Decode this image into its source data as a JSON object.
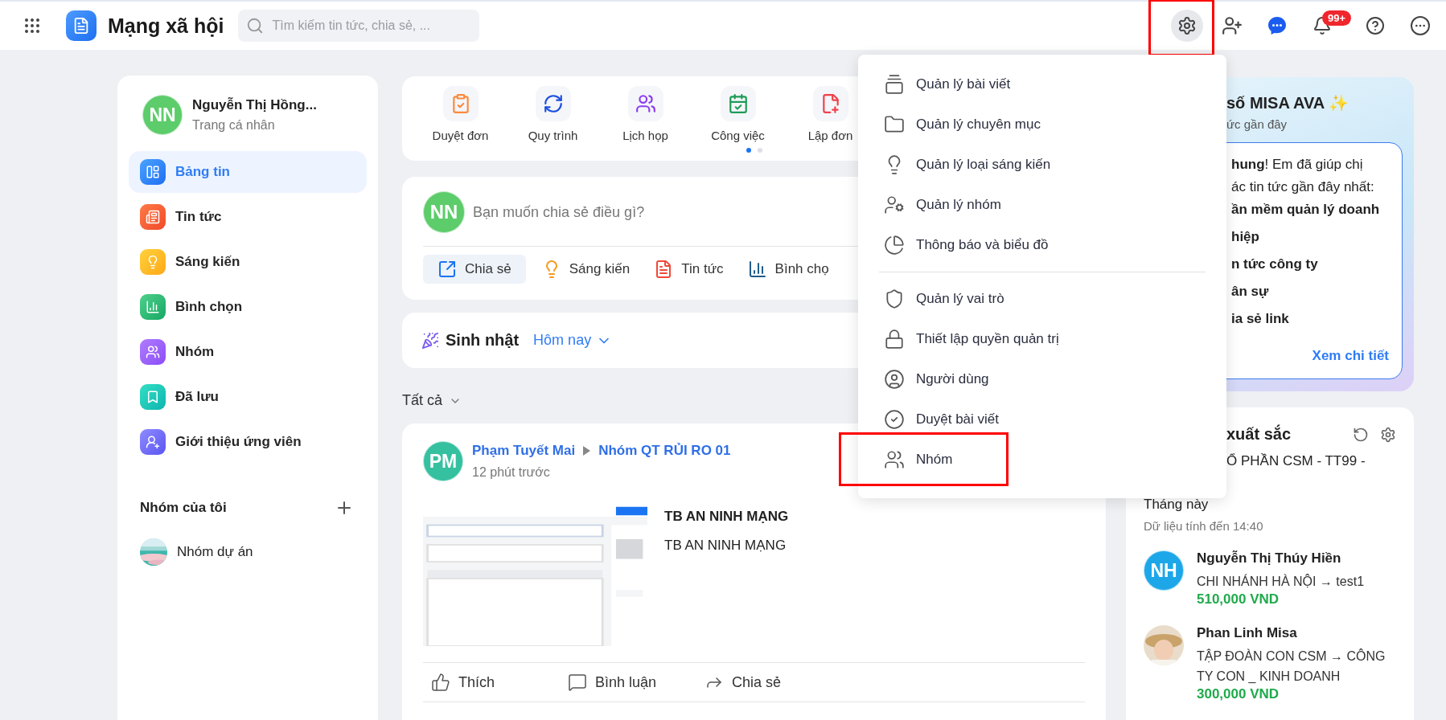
{
  "top_bar": {
    "title": "Mạng xã hội",
    "search": {
      "placeholder": "Tìm kiếm tin tức, chia sẻ, ..."
    },
    "actions": [
      {
        "kind": "settings",
        "selected": true,
        "annotated": true
      },
      {
        "kind": "add-user",
        "selected": false,
        "annotated": false
      },
      {
        "kind": "chat",
        "selected": false,
        "annotated": false
      },
      {
        "kind": "notifications",
        "selected": false,
        "annotated": false,
        "badge": "99+"
      },
      {
        "kind": "help",
        "selected": false,
        "annotated": false
      },
      {
        "kind": "more",
        "selected": false,
        "annotated": false
      }
    ]
  },
  "sidebar": {
    "profile": {
      "initials": "NN",
      "name": "Nguyễn Thị Hồng...",
      "subtitle": "Trang cá nhân"
    },
    "items": [
      {
        "label": "Bảng tin",
        "selected": true
      },
      {
        "label": "Tin tức",
        "selected": false
      },
      {
        "label": "Sáng kiến",
        "selected": false
      },
      {
        "label": "Bình chọn",
        "selected": false
      },
      {
        "label": "Nhóm",
        "selected": false
      },
      {
        "label": "Đã lưu",
        "selected": false
      },
      {
        "label": "Giới thiệu ứng viên",
        "selected": false
      }
    ],
    "groups_title": "Nhóm của tôi",
    "groups": [
      {
        "name": "Nhóm dự án",
        "kind": "picture"
      }
    ]
  },
  "shortcuts": {
    "items": [
      "Duyệt đơn",
      "Quy trình",
      "Lịch họp",
      "Công việc",
      "Lập đơn"
    ],
    "pages": [
      {
        "selected": true
      },
      {
        "selected": false
      }
    ]
  },
  "composer": {
    "initials": "NN",
    "placeholder": "Bạn muốn chia sẻ điều gì?",
    "actions": [
      {
        "label": "Chia sẻ",
        "selected": true
      },
      {
        "label": "Sáng kiến",
        "selected": false
      },
      {
        "label": "Tin tức",
        "selected": false
      },
      {
        "label": "Bình chọ",
        "selected": false
      }
    ]
  },
  "birthday": {
    "title": "Sinh nhật",
    "filter": "Hôm nay"
  },
  "feed_filter": "Tất cả",
  "post": {
    "initials": "PM",
    "author": "Phạm Tuyết Mai",
    "group": "Nhóm QT RỦI RO 01",
    "time": "12 phút trước",
    "image": {
      "kind": "picture"
    },
    "title": "TB AN NINH MẠNG",
    "body": "TB AN NINH MẠNG",
    "actions": [
      "Thích",
      "Bình luận",
      "Chia sẻ"
    ]
  },
  "ava_card": {
    "title": "số MISA AVA ✨",
    "subtitle": "ức gần đây",
    "lines": [
      {
        "text": "**hung**! Em đã giúp chị",
        "bold": false
      },
      {
        "text": "ác tin tức gần đây nhất:",
        "bold": false
      },
      {
        "text": "ần mềm quản lý doanh",
        "bold": true
      },
      {
        "text": "hiệp",
        "bold": true
      },
      {
        "text": "n tức công ty",
        "bold": true
      },
      {
        "text": "ân sự",
        "bold": true
      },
      {
        "text": "ia sẻ link",
        "bold": true
      }
    ],
    "link": "Xem chi tiết"
  },
  "ranking": {
    "title": "xuất sắc",
    "subtitle": "Ổ PHẦN CSM - TT99 -",
    "period": "Tháng này",
    "updated": "Dữ liệu tính đến 14:40",
    "entries": [
      {
        "initials": "NH",
        "name": "Nguyễn Thị Thúy Hiền",
        "unit": "CHI NHÁNH HÀ NỘI → test1",
        "amount": "510,000 VND"
      },
      {
        "kind": "picture",
        "name": "Phan Linh Misa",
        "unit": "TẬP ĐOÀN CON CSM → CÔNG TY CON _ KINH DOANH",
        "amount": "300,000 VND"
      }
    ]
  },
  "settings_menu": {
    "groups": [
      [
        {
          "label": "Quản lý bài viết",
          "annotated": false
        },
        {
          "label": "Quản lý chuyên mục",
          "annotated": false
        },
        {
          "label": "Quản lý loại sáng kiến",
          "annotated": false
        },
        {
          "label": "Quản lý nhóm",
          "annotated": false
        },
        {
          "label": "Thông báo và biểu đồ",
          "annotated": false
        }
      ],
      [
        {
          "label": "Quản lý vai trò",
          "annotated": false
        },
        {
          "label": "Thiết lập quyền quản trị",
          "annotated": false
        },
        {
          "label": "Người dùng",
          "annotated": false
        },
        {
          "label": "Duyệt bài viết",
          "annotated": false
        },
        {
          "label": "Nhóm",
          "annotated": true
        }
      ]
    ]
  }
}
